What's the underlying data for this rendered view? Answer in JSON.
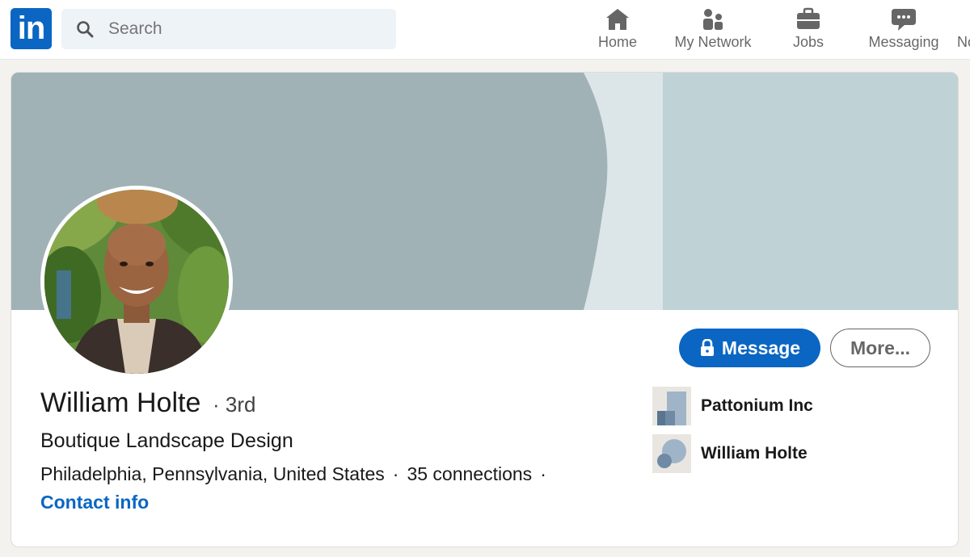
{
  "nav": {
    "logo_text": "in",
    "search_placeholder": "Search",
    "items": [
      {
        "label": "Home",
        "icon": "home-icon"
      },
      {
        "label": "My Network",
        "icon": "people-icon"
      },
      {
        "label": "Jobs",
        "icon": "briefcase-icon"
      },
      {
        "label": "Messaging",
        "icon": "chat-icon"
      },
      {
        "label": "No",
        "icon": "bell-icon"
      }
    ]
  },
  "profile": {
    "name": "William Holte",
    "degree": "· 3rd",
    "headline": "Boutique Landscape Design",
    "location": "Philadelphia, Pennsylvania, United States",
    "connections": "35 connections",
    "contact_info": "Contact info"
  },
  "actions": {
    "message_label": "Message",
    "more_label": "More..."
  },
  "organizations": [
    {
      "name": "Pattonium Inc",
      "icon": "company-logo"
    },
    {
      "name": "William Holte",
      "icon": "school-logo"
    }
  ],
  "colors": {
    "brand": "#0a66c2",
    "banner_dark": "#a0b2b6",
    "banner_light": "#dce6e8",
    "banner_right": "#bfd2d6"
  }
}
